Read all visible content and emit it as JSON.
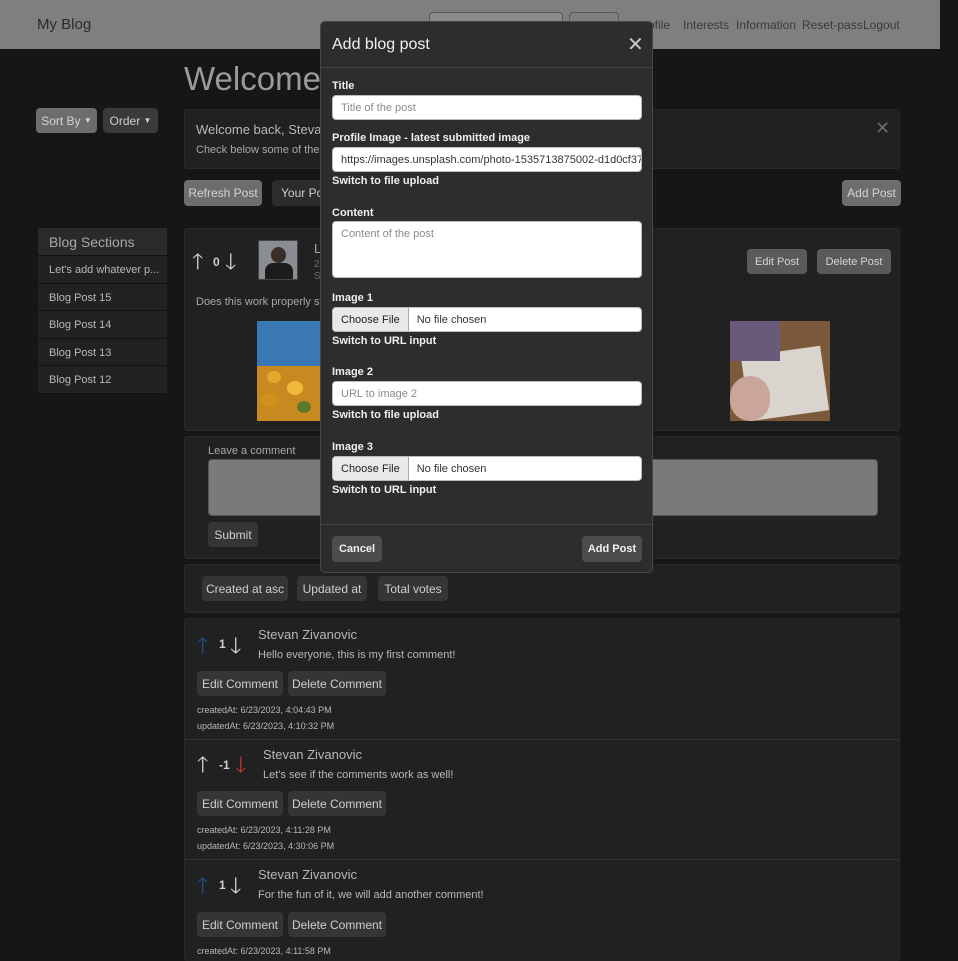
{
  "navbar": {
    "brand": "My Blog",
    "links": [
      "ofile",
      "Interests",
      "Information",
      "Reset-pass",
      "Logout"
    ]
  },
  "page": {
    "welcome_title": "Welcome",
    "sort_by_label": "Sort By",
    "order_label": "Order",
    "alert_title": "Welcome back, Stevan",
    "alert_text": "Check below some of the b",
    "refresh_label": "Refresh Post",
    "your_posts_label": "Your Pos",
    "add_post_label": "Add Post"
  },
  "sections": {
    "header": "Blog Sections",
    "items": [
      "Let's add whatever p...",
      "Blog Post 15",
      "Blog Post 14",
      "Blog Post 13",
      "Blog Post 12"
    ]
  },
  "post": {
    "votes": "0",
    "author_initial": "L",
    "meta1": "2",
    "meta2": "S",
    "text": "Does this work properly sti",
    "edit_label": "Edit Post",
    "delete_label": "Delete Post"
  },
  "comment_form": {
    "label": "Leave a comment",
    "submit_label": "Submit"
  },
  "sort_bar": {
    "buttons": [
      "Created at asc",
      "Updated at",
      "Total votes"
    ]
  },
  "comments": [
    {
      "votes": "1",
      "author": "Stevan Zivanovic",
      "text": "Hello everyone, this is my first comment!",
      "edit": "Edit Comment",
      "delete": "Delete Comment",
      "created": "createdAt: 6/23/2023, 4:04:43 PM",
      "updated": "updatedAt: 6/23/2023, 4:10:32 PM",
      "up_color": "#1f4f8a",
      "down_color": "#d0d0d0"
    },
    {
      "votes": "-1",
      "author": "Stevan Zivanovic",
      "text": "Let's see if the comments work as well!",
      "edit": "Edit Comment",
      "delete": "Delete Comment",
      "created": "createdAt: 6/23/2023, 4:11:28 PM",
      "updated": "updatedAt: 6/23/2023, 4:30:06 PM",
      "up_color": "#d0d0d0",
      "down_color": "#b03a2e"
    },
    {
      "votes": "1",
      "author": "Stevan Zivanovic",
      "text": "For the fun of it, we will add another comment!",
      "edit": "Edit Comment",
      "delete": "Delete Comment",
      "created": "createdAt: 6/23/2023, 4:11:58 PM",
      "updated": "",
      "up_color": "#1f4f8a",
      "down_color": "#d0d0d0"
    }
  ],
  "modal": {
    "title": "Add blog post",
    "title_label": "Title",
    "title_placeholder": "Title of the post",
    "profile_label": "Profile Image - latest submitted image",
    "profile_value": "https://images.unsplash.com/photo-1535713875002-d1d0cf37",
    "switch_file": "Switch to file upload",
    "content_label": "Content",
    "content_placeholder": "Content of the post",
    "image1_label": "Image 1",
    "choose_file": "Choose File",
    "no_file": "No file chosen",
    "switch_url": "Switch to URL input",
    "image2_label": "Image 2",
    "image2_placeholder": "URL to image 2",
    "image3_label": "Image 3",
    "cancel_label": "Cancel",
    "add_label": "Add Post"
  }
}
